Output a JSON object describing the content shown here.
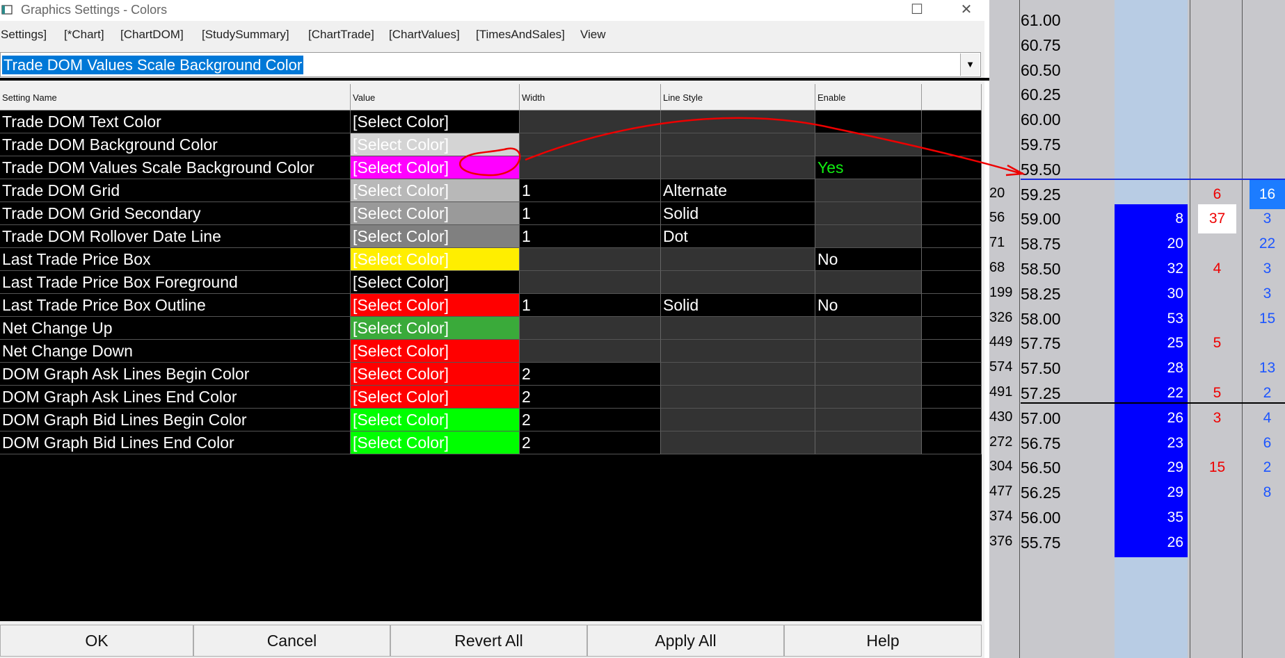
{
  "window": {
    "title": "Graphics Settings - Colors",
    "maximize_glyph": "☐",
    "close_glyph": "✕"
  },
  "tabs": [
    "Settings]",
    "[*Chart]",
    "[ChartDOM]",
    "[StudySummary]",
    "[ChartTrade]",
    "[ChartValues]",
    "[TimesAndSales]",
    "View"
  ],
  "dropdown": {
    "selected": "Trade DOM Values Scale Background Color",
    "arrow": "▼"
  },
  "columns": {
    "name": "Setting Name",
    "value": "Value",
    "width": "Width",
    "line_style": "Line Style",
    "enable": "Enable"
  },
  "settings": [
    {
      "name": "Trade DOM Text Color",
      "value": "[Select Color]",
      "width": "",
      "line_style": "",
      "enable": "",
      "bg": "#000000",
      "fg": "#ffffff",
      "enable_color": "#ffffff",
      "enable_bg": "#000000"
    },
    {
      "name": "Trade DOM Background Color",
      "value": "[Select Color]",
      "width": "",
      "line_style": "",
      "enable": "",
      "bg": "#d4d4d4",
      "fg": "#ffffff",
      "enable_color": "#ffffff",
      "enable_bg": "#333333"
    },
    {
      "name": "Trade DOM Values Scale Background Color",
      "value": "[Select Color]",
      "width": "",
      "line_style": "",
      "enable": "Yes",
      "bg": "#ff00ff",
      "fg": "#ffffff",
      "enable_color": "#11ee11",
      "enable_bg": "#000000"
    },
    {
      "name": "Trade DOM Grid",
      "value": "[Select Color]",
      "width": "1",
      "line_style": "Alternate",
      "enable": "",
      "bg": "#b8b8b8",
      "fg": "#ffffff",
      "enable_color": "#ffffff",
      "enable_bg": "#333333"
    },
    {
      "name": "Trade DOM Grid Secondary",
      "value": "[Select Color]",
      "width": "1",
      "line_style": "Solid",
      "enable": "",
      "bg": "#9a9a9a",
      "fg": "#ffffff",
      "enable_color": "#ffffff",
      "enable_bg": "#333333"
    },
    {
      "name": "Trade DOM Rollover Date Line",
      "value": "[Select Color]",
      "width": "1",
      "line_style": "Dot",
      "enable": "",
      "bg": "#808080",
      "fg": "#ffffff",
      "enable_color": "#ffffff",
      "enable_bg": "#333333"
    },
    {
      "name": "Last Trade Price Box",
      "value": "[Select Color]",
      "width": "",
      "line_style": "",
      "enable": "No",
      "bg": "#ffee00",
      "fg": "#ffffff",
      "enable_color": "#ffffff",
      "enable_bg": "#000000"
    },
    {
      "name": "Last Trade Price Box Foreground",
      "value": "[Select Color]",
      "width": "",
      "line_style": "",
      "enable": "",
      "bg": "#000000",
      "fg": "#ffffff",
      "enable_color": "#ffffff",
      "enable_bg": "#333333"
    },
    {
      "name": "Last Trade Price Box Outline",
      "value": "[Select Color]",
      "width": "1",
      "line_style": "Solid",
      "enable": "No",
      "bg": "#ff0000",
      "fg": "#ffffff",
      "enable_color": "#ffffff",
      "enable_bg": "#000000"
    },
    {
      "name": "Net Change Up",
      "value": "[Select Color]",
      "width": "",
      "line_style": "",
      "enable": "",
      "bg": "#3aaa3a",
      "fg": "#ffffff",
      "enable_color": "#ffffff",
      "enable_bg": "#333333"
    },
    {
      "name": "Net Change Down",
      "value": "[Select Color]",
      "width": "",
      "line_style": "",
      "enable": "",
      "bg": "#ff0000",
      "fg": "#ffffff",
      "enable_color": "#ffffff",
      "enable_bg": "#333333"
    },
    {
      "name": "DOM Graph Ask Lines Begin Color",
      "value": "[Select Color]",
      "width": "2",
      "line_style": "",
      "enable": "",
      "bg": "#ff0000",
      "fg": "#ffffff",
      "enable_color": "#ffffff",
      "enable_bg": "#333333"
    },
    {
      "name": "DOM Graph Ask Lines End Color",
      "value": "[Select Color]",
      "width": "2",
      "line_style": "",
      "enable": "",
      "bg": "#ff0000",
      "fg": "#ffffff",
      "enable_color": "#ffffff",
      "enable_bg": "#333333"
    },
    {
      "name": "DOM Graph Bid Lines Begin Color",
      "value": "[Select Color]",
      "width": "2",
      "line_style": "",
      "enable": "",
      "bg": "#00ff00",
      "fg": "#ffffff",
      "enable_color": "#ffffff",
      "enable_bg": "#333333"
    },
    {
      "name": "DOM Graph Bid Lines End Color",
      "value": "[Select Color]",
      "width": "2",
      "line_style": "",
      "enable": "",
      "bg": "#00ff00",
      "fg": "#ffffff",
      "enable_color": "#ffffff",
      "enable_bg": "#333333"
    }
  ],
  "buttons": [
    "OK",
    "Cancel",
    "Revert All",
    "Apply All",
    "Help"
  ],
  "dom": {
    "ladder": [
      {
        "vol": "",
        "price": "61.00",
        "bid": "",
        "sell": "",
        "buy": ""
      },
      {
        "vol": "",
        "price": "60.75",
        "bid": "",
        "sell": "",
        "buy": ""
      },
      {
        "vol": "",
        "price": "60.50",
        "bid": "",
        "sell": "",
        "buy": ""
      },
      {
        "vol": "",
        "price": "60.25",
        "bid": "",
        "sell": "",
        "buy": ""
      },
      {
        "vol": "",
        "price": "60.00",
        "bid": "",
        "sell": "",
        "buy": ""
      },
      {
        "vol": "",
        "price": "59.75",
        "bid": "",
        "sell": "",
        "buy": ""
      },
      {
        "vol": "",
        "price": "59.50",
        "bid": "",
        "sell": "",
        "buy": ""
      },
      {
        "vol": "20",
        "price": "59.25",
        "bid": "",
        "sell": "6",
        "buy": "16"
      },
      {
        "vol": "56",
        "price": "59.00",
        "bid": "8",
        "sell": "37",
        "buy": "3"
      },
      {
        "vol": "71",
        "price": "58.75",
        "bid": "20",
        "sell": "",
        "buy": "22"
      },
      {
        "vol": "68",
        "price": "58.50",
        "bid": "32",
        "sell": "4",
        "buy": "3"
      },
      {
        "vol": "199",
        "price": "58.25",
        "bid": "30",
        "sell": "",
        "buy": "3"
      },
      {
        "vol": "326",
        "price": "58.00",
        "bid": "53",
        "sell": "",
        "buy": "15"
      },
      {
        "vol": "449",
        "price": "57.75",
        "bid": "25",
        "sell": "5",
        "buy": ""
      },
      {
        "vol": "574",
        "price": "57.50",
        "bid": "28",
        "sell": "",
        "buy": "13"
      },
      {
        "vol": "491",
        "price": "57.25",
        "bid": "22",
        "sell": "5",
        "buy": "2"
      },
      {
        "vol": "430",
        "price": "57.00",
        "bid": "26",
        "sell": "3",
        "buy": "4"
      },
      {
        "vol": "272",
        "price": "56.75",
        "bid": "23",
        "sell": "",
        "buy": "6"
      },
      {
        "vol": "304",
        "price": "56.50",
        "bid": "29",
        "sell": "15",
        "buy": "2"
      },
      {
        "vol": "477",
        "price": "56.25",
        "bid": "29",
        "sell": "",
        "buy": "8"
      },
      {
        "vol": "374",
        "price": "56.00",
        "bid": "35",
        "sell": "",
        "buy": ""
      },
      {
        "vol": "376",
        "price": "55.75",
        "bid": "26",
        "sell": "",
        "buy": ""
      }
    ]
  }
}
